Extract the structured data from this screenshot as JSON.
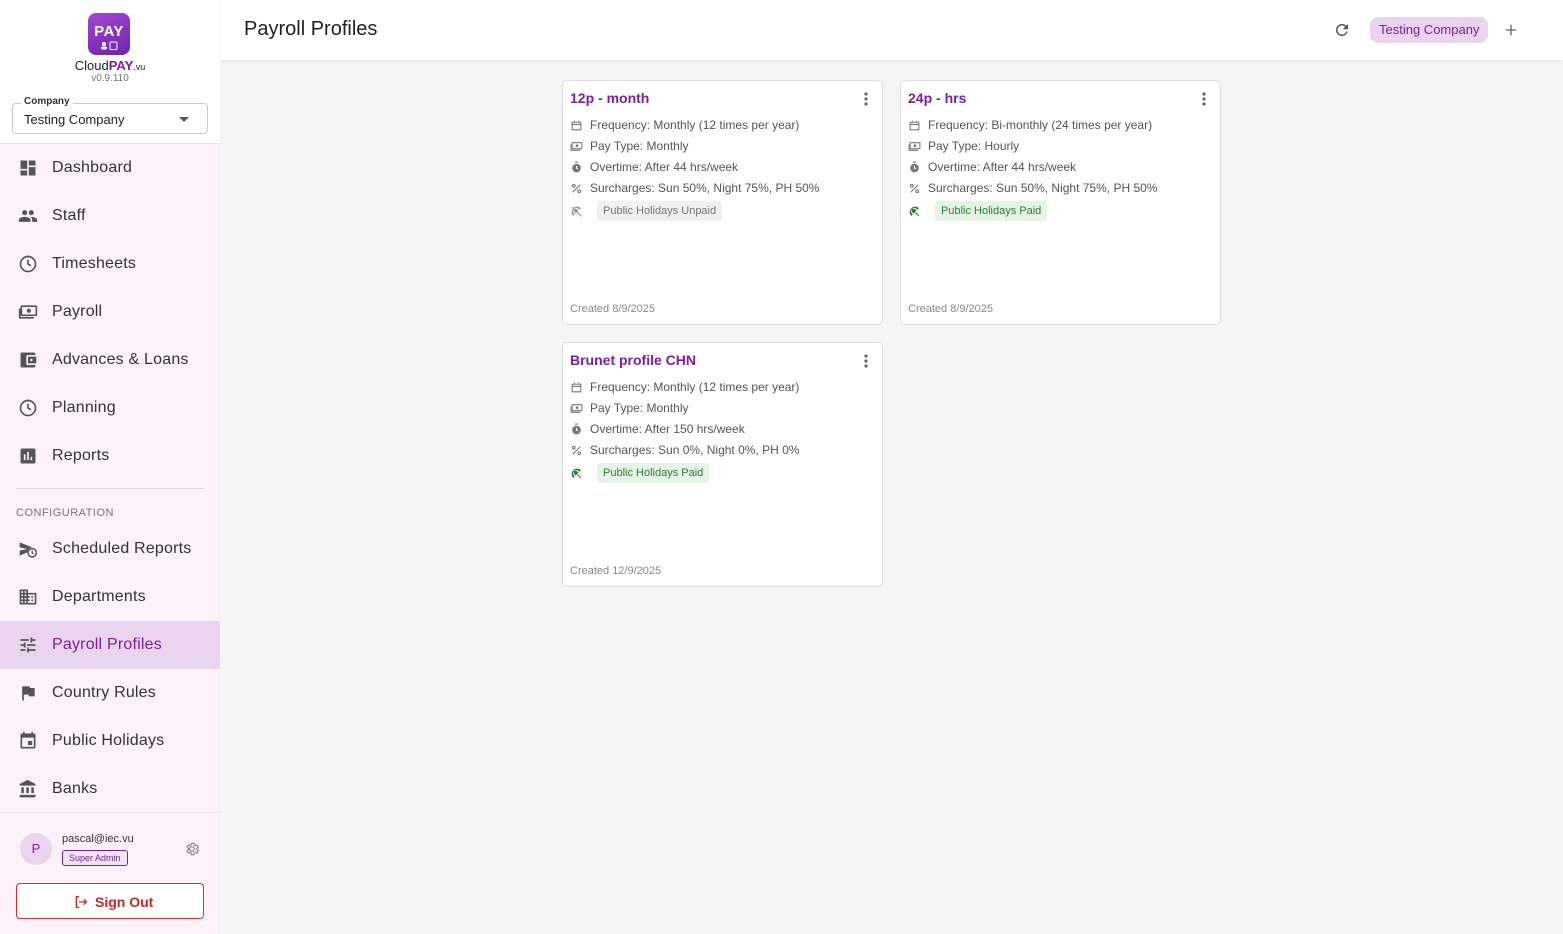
{
  "app": {
    "logo_text": "PAY",
    "brand_main": "Cloud",
    "brand_accent": "PAY",
    "brand_suffix": ".vu",
    "version": "v0.9.110"
  },
  "company_select": {
    "label": "Company",
    "value": "Testing Company"
  },
  "nav": {
    "items": [
      {
        "label": "Dashboard",
        "icon": "dashboard-icon"
      },
      {
        "label": "Staff",
        "icon": "people-icon"
      },
      {
        "label": "Timesheets",
        "icon": "clock-icon"
      },
      {
        "label": "Payroll",
        "icon": "cash-icon"
      },
      {
        "label": "Advances & Loans",
        "icon": "wallet-icon"
      },
      {
        "label": "Planning",
        "icon": "clock-icon"
      },
      {
        "label": "Reports",
        "icon": "bar-chart-icon"
      }
    ],
    "section_label": "CONFIGURATION",
    "config_items": [
      {
        "label": "Scheduled Reports",
        "icon": "schedule-send-icon"
      },
      {
        "label": "Departments",
        "icon": "domain-icon"
      },
      {
        "label": "Payroll Profiles",
        "icon": "tune-icon",
        "active": true
      },
      {
        "label": "Country Rules",
        "icon": "flag-icon"
      },
      {
        "label": "Public Holidays",
        "icon": "calendar-icon"
      },
      {
        "label": "Banks",
        "icon": "bank-icon"
      }
    ]
  },
  "user": {
    "initial": "P",
    "email": "pascal@iec.vu",
    "role": "Super Admin",
    "sign_out": "Sign Out"
  },
  "header": {
    "title": "Payroll Profiles",
    "company_chip": "Testing Company"
  },
  "profiles": [
    {
      "name": "12p - month",
      "frequency": "Frequency: Monthly (12 times per year)",
      "pay_type": "Pay Type: Monthly",
      "overtime": "Overtime: After 44 hrs/week",
      "surcharges": "Surcharges: Sun 50%, Night 75%, PH 50%",
      "public_holidays": "Public Holidays Unpaid",
      "public_holidays_paid": false,
      "created": "Created 8/9/2025"
    },
    {
      "name": "24p - hrs",
      "frequency": "Frequency: Bi-monthly (24 times per year)",
      "pay_type": "Pay Type: Hourly",
      "overtime": "Overtime: After 44 hrs/week",
      "surcharges": "Surcharges: Sun 50%, Night 75%, PH 50%",
      "public_holidays": "Public Holidays Paid",
      "public_holidays_paid": true,
      "created": "Created 8/9/2025"
    },
    {
      "name": "Brunet profile CHN",
      "frequency": "Frequency: Monthly (12 times per year)",
      "pay_type": "Pay Type: Monthly",
      "overtime": "Overtime: After 150 hrs/week",
      "surcharges": "Surcharges: Sun 0%, Night 0%, PH 0%",
      "public_holidays": "Public Holidays Paid",
      "public_holidays_paid": true,
      "created": "Created 12/9/2025"
    }
  ],
  "colors": {
    "accent": "#7b1fa2",
    "paid": "#2e7d32",
    "unpaid": "#757575",
    "danger": "#c62828"
  }
}
